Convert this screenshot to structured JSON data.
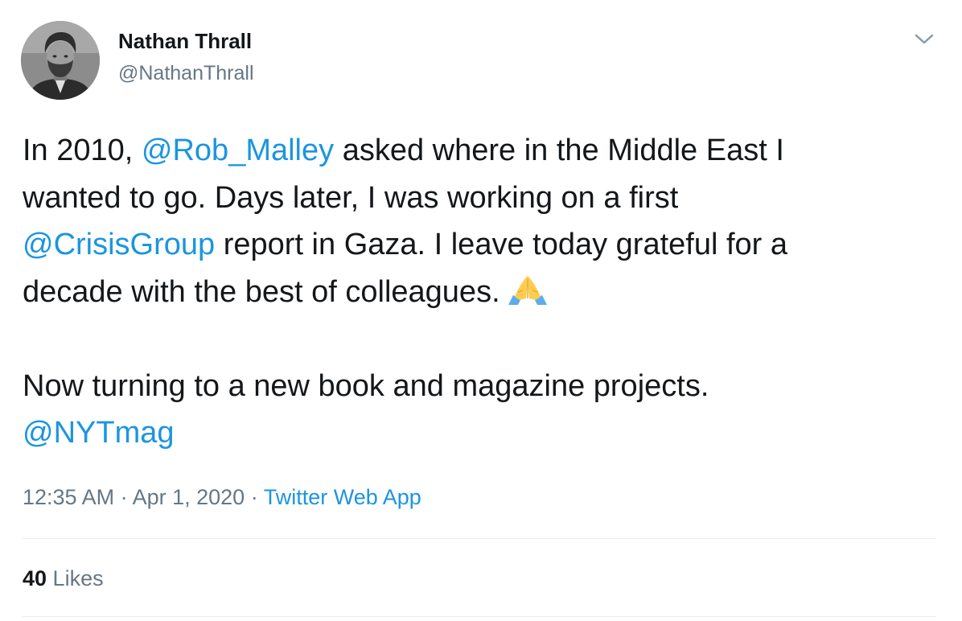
{
  "author": {
    "name": "Nathan Thrall",
    "handle": "@NathanThrall"
  },
  "tweet": {
    "line1_pre": "In 2010, ",
    "line1_mention": "@Rob_Malley",
    "line1_post": " asked where in the Middle East I",
    "line2": "wanted to go. Days later, I was working on a first",
    "line3_mention": "@CrisisGroup",
    "line3_post": " report in Gaza. I leave today grateful for a",
    "line4": "decade with the best of colleagues.",
    "line5": "Now turning to a new book and magazine projects.",
    "line6_mention": "@NYTmag",
    "emoji": "folded-hands"
  },
  "meta": {
    "time": "12:35 AM",
    "sep1": " · ",
    "date": "Apr 1, 2020",
    "sep2": " · ",
    "source": "Twitter Web App"
  },
  "stats": {
    "likes_count": "40",
    "likes_label": " Likes"
  },
  "colors": {
    "link": "#1b95e0",
    "secondary_text": "#657786",
    "primary_text": "#14171a",
    "divider": "#e6ecf0"
  },
  "icons": {
    "menu": "chevron-down-icon",
    "emoji": "folded-hands-icon"
  }
}
